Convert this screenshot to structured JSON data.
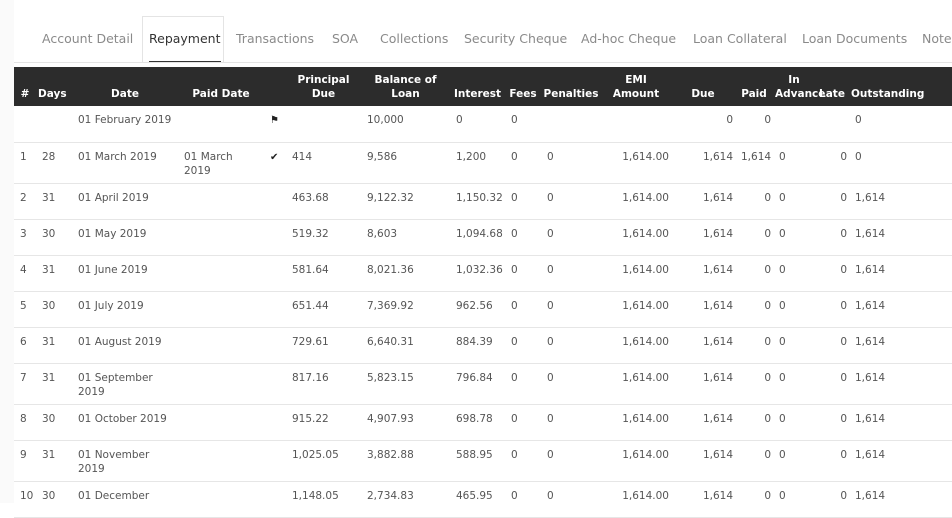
{
  "tabs": [
    {
      "label": "Account Detail",
      "active": false
    },
    {
      "label": "Repayment",
      "active": true
    },
    {
      "label": "Transactions",
      "active": false
    },
    {
      "label": "SOA",
      "active": false
    },
    {
      "label": "Collections",
      "active": false
    },
    {
      "label": "Security Cheque",
      "active": false
    },
    {
      "label": "Ad-hoc Cheque",
      "active": false
    },
    {
      "label": "Loan Collateral",
      "active": false
    },
    {
      "label": "Loan Documents",
      "active": false
    },
    {
      "label": "Note",
      "active": false
    }
  ],
  "table": {
    "headers": {
      "num": "#",
      "days": "Days",
      "date": "Date",
      "paid_date": "Paid Date",
      "principal_due_1": "Principal",
      "principal_due_2": "Due",
      "balance_1": "Balance of",
      "balance_2": "Loan",
      "interest": "Interest",
      "fees": "Fees",
      "penalties": "Penalties",
      "emi_1": "EMI",
      "emi_2": "Amount",
      "due": "Due",
      "paid": "Paid",
      "in_advance_1": "In",
      "in_advance_2": "Advance",
      "late": "Late",
      "outstanding": "Outstanding"
    },
    "rows": [
      {
        "num": "",
        "days": "",
        "date": "01 February 2019",
        "paid_date": "",
        "status_icon": "flag-icon",
        "principal": "",
        "balance": "10,000",
        "interest": "0",
        "fees": "0",
        "penalties": "",
        "emi": "",
        "due": "0",
        "paid": "0",
        "advance": "",
        "late": "",
        "outstanding": "0"
      },
      {
        "num": "1",
        "days": "28",
        "date": "01 March 2019",
        "paid_date": "01 March 2019",
        "status_icon": "check-icon",
        "principal": "414",
        "balance": "9,586",
        "interest": "1,200",
        "fees": "0",
        "penalties": "0",
        "emi": "1,614.00",
        "due": "1,614",
        "paid": "1,614",
        "advance": "0",
        "late": "0",
        "outstanding": "0"
      },
      {
        "num": "2",
        "days": "31",
        "date": "01 April 2019",
        "paid_date": "",
        "status_icon": "",
        "principal": "463.68",
        "balance": "9,122.32",
        "interest": "1,150.32",
        "fees": "0",
        "penalties": "0",
        "emi": "1,614.00",
        "due": "1,614",
        "paid": "0",
        "advance": "0",
        "late": "0",
        "outstanding": "1,614"
      },
      {
        "num": "3",
        "days": "30",
        "date": "01 May 2019",
        "paid_date": "",
        "status_icon": "",
        "principal": "519.32",
        "balance": "8,603",
        "interest": "1,094.68",
        "fees": "0",
        "penalties": "0",
        "emi": "1,614.00",
        "due": "1,614",
        "paid": "0",
        "advance": "0",
        "late": "0",
        "outstanding": "1,614"
      },
      {
        "num": "4",
        "days": "31",
        "date": "01 June 2019",
        "paid_date": "",
        "status_icon": "",
        "principal": "581.64",
        "balance": "8,021.36",
        "interest": "1,032.36",
        "fees": "0",
        "penalties": "0",
        "emi": "1,614.00",
        "due": "1,614",
        "paid": "0",
        "advance": "0",
        "late": "0",
        "outstanding": "1,614"
      },
      {
        "num": "5",
        "days": "30",
        "date": "01 July 2019",
        "paid_date": "",
        "status_icon": "",
        "principal": "651.44",
        "balance": "7,369.92",
        "interest": "962.56",
        "fees": "0",
        "penalties": "0",
        "emi": "1,614.00",
        "due": "1,614",
        "paid": "0",
        "advance": "0",
        "late": "0",
        "outstanding": "1,614"
      },
      {
        "num": "6",
        "days": "31",
        "date": "01 August 2019",
        "paid_date": "",
        "status_icon": "",
        "principal": "729.61",
        "balance": "6,640.31",
        "interest": "884.39",
        "fees": "0",
        "penalties": "0",
        "emi": "1,614.00",
        "due": "1,614",
        "paid": "0",
        "advance": "0",
        "late": "0",
        "outstanding": "1,614"
      },
      {
        "num": "7",
        "days": "31",
        "date": "01 September 2019",
        "paid_date": "",
        "status_icon": "",
        "principal": "817.16",
        "balance": "5,823.15",
        "interest": "796.84",
        "fees": "0",
        "penalties": "0",
        "emi": "1,614.00",
        "due": "1,614",
        "paid": "0",
        "advance": "0",
        "late": "0",
        "outstanding": "1,614"
      },
      {
        "num": "8",
        "days": "30",
        "date": "01 October 2019",
        "paid_date": "",
        "status_icon": "",
        "principal": "915.22",
        "balance": "4,907.93",
        "interest": "698.78",
        "fees": "0",
        "penalties": "0",
        "emi": "1,614.00",
        "due": "1,614",
        "paid": "0",
        "advance": "0",
        "late": "0",
        "outstanding": "1,614"
      },
      {
        "num": "9",
        "days": "31",
        "date": "01 November 2019",
        "paid_date": "",
        "status_icon": "",
        "principal": "1,025.05",
        "balance": "3,882.88",
        "interest": "588.95",
        "fees": "0",
        "penalties": "0",
        "emi": "1,614.00",
        "due": "1,614",
        "paid": "0",
        "advance": "0",
        "late": "0",
        "outstanding": "1,614"
      },
      {
        "num": "10",
        "days": "30",
        "date": "01 December",
        "paid_date": "",
        "status_icon": "",
        "principal": "1,148.05",
        "balance": "2,734.83",
        "interest": "465.95",
        "fees": "0",
        "penalties": "0",
        "emi": "1,614.00",
        "due": "1,614",
        "paid": "0",
        "advance": "0",
        "late": "0",
        "outstanding": "1,614"
      }
    ]
  },
  "colors": {
    "header_bg": "#2c2c2c",
    "header_text": "#ffffff",
    "tab_inactive": "#8a8a8a",
    "tab_active": "#333333"
  }
}
